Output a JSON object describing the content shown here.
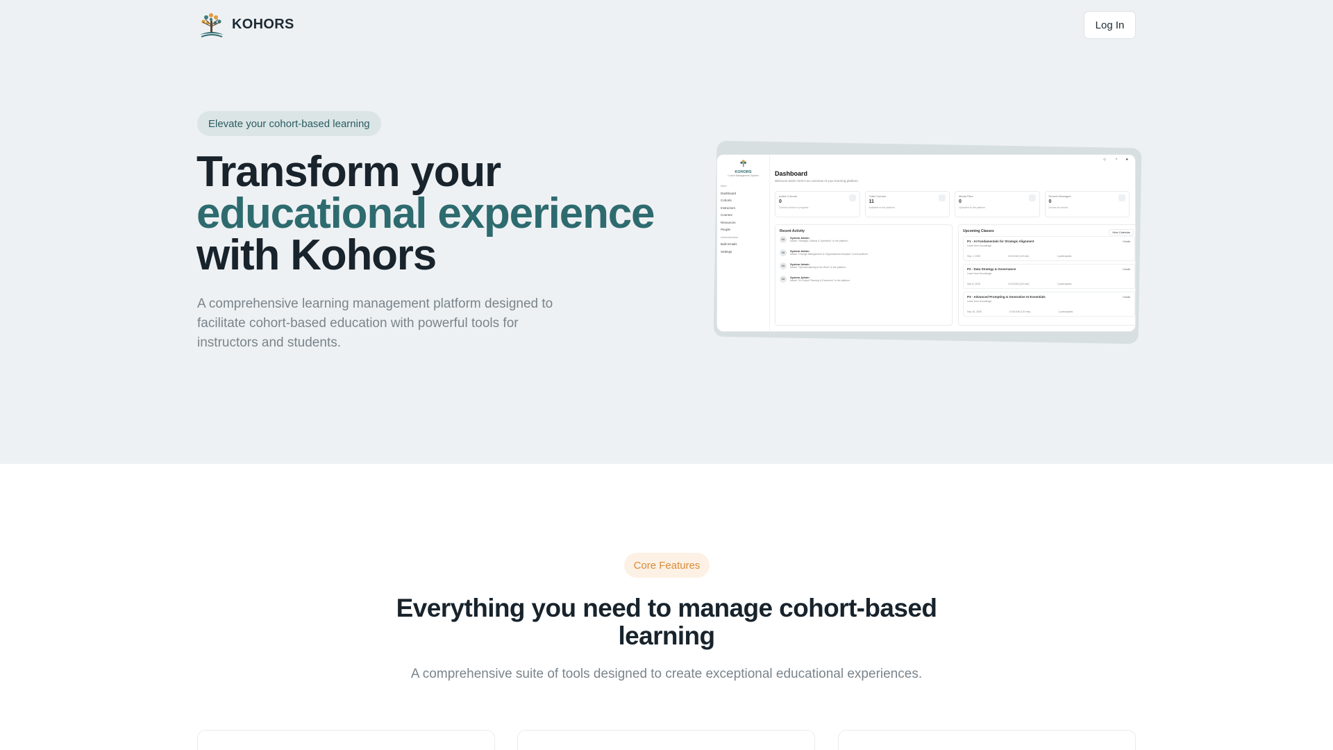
{
  "header": {
    "brand": "KOHORS",
    "login_label": "Log In"
  },
  "hero": {
    "badge": "Elevate your cohort-based learning",
    "title_line1": "Transform your",
    "title_line2": "educational experience",
    "title_line3": "with Kohors",
    "description": "A comprehensive learning management platform designed to facilitate cohort-based education with powerful tools for instructors and students."
  },
  "preview": {
    "brand": "KOHORS",
    "brand_sub": "Cohort Management System",
    "nav_main": "Main",
    "nav_items": [
      "Dashboard",
      "Cohorts",
      "Instructors",
      "Courses",
      "Resources",
      "People"
    ],
    "nav_admin": "Administration",
    "admin_items": [
      "Bulk Emails",
      "Settings"
    ],
    "title": "Dashboard",
    "subtitle": "Welcome back! Here's an overview of your learning platform",
    "cards": [
      {
        "label": "Active Cohorts",
        "value": "0",
        "desc": "Current cohorts in progress"
      },
      {
        "label": "Total Courses",
        "value": "11",
        "desc": "Available in the platform"
      },
      {
        "label": "Media Files",
        "value": "0",
        "desc": "Uploaded to the platform"
      },
      {
        "label": "Recent Messages",
        "value": "0",
        "desc": "Across all cohorts"
      }
    ],
    "activity_title": "Recent Activity",
    "activity": [
      {
        "initials": "SA",
        "name": "System Admin",
        "msg": "Added \"Strategic Outlook & Operation\" to the platform"
      },
      {
        "initials": "SA",
        "name": "System Admin",
        "msg": "Added \"Change Management & Organizational Adoption\" to the platform"
      },
      {
        "initials": "SA",
        "name": "System Admin",
        "msg": "Added \"Operationalizing AI for Work\" to the platform"
      },
      {
        "initials": "SA",
        "name": "System Admin",
        "msg": "Added \"AI Project Planning & Execution\" to the platform"
      }
    ],
    "classes_title": "Upcoming Classes",
    "view_calendar": "View Calendar",
    "classes": [
      {
        "name": "P1 - AI Fundamentals for Strategic Alignment",
        "sub": "Learn from Knowledge",
        "date": "Sep 1, 2025",
        "time": "10:00 AM (120 min)",
        "people": "1 participants",
        "detail": "Details"
      },
      {
        "name": "P2 - Data Strategy & Governance",
        "sub": "Learn from Knowledge",
        "date": "Sep 8, 2025",
        "time": "10:00 AM (120 min)",
        "people": "1 participants",
        "detail": "Details"
      },
      {
        "name": "P3 - Advanced Prompting & Generative AI Essentials",
        "sub": "Learn from Knowledge",
        "date": "Sep 15, 2025",
        "time": "10:00 AM (120 min)",
        "people": "1 participants",
        "detail": "Details"
      }
    ]
  },
  "features": {
    "badge": "Core Features",
    "title": "Everything you need to manage cohort-based learning",
    "description": "A comprehensive suite of tools designed to create exceptional educational experiences."
  }
}
